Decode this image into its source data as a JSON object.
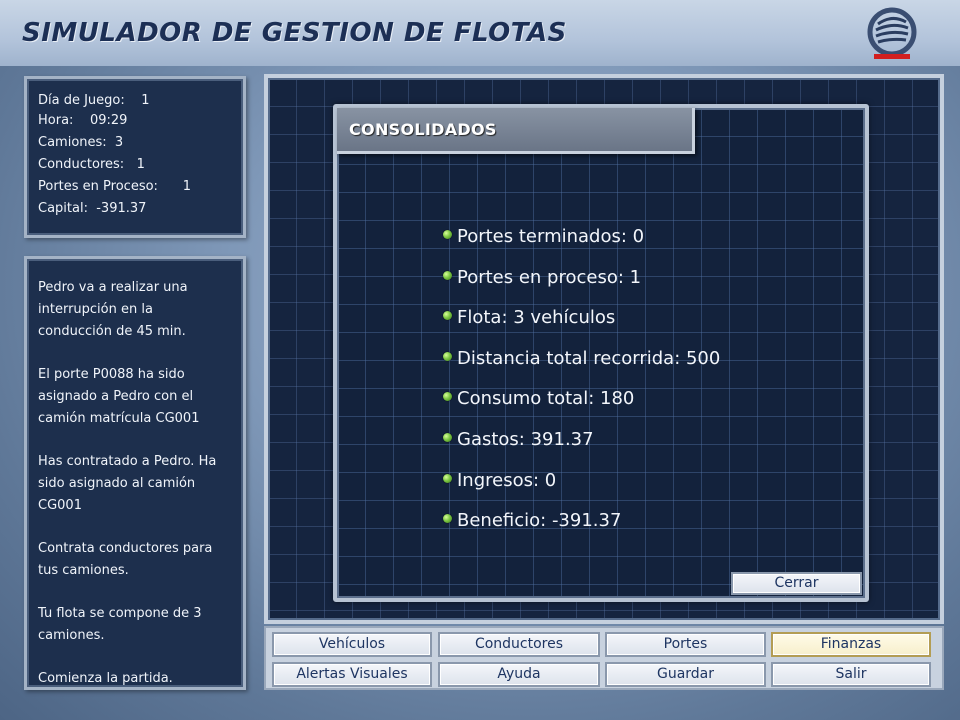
{
  "header": {
    "title": "SIMULADOR DE GESTION DE FLOTAS",
    "logo_icon": "company-logo-icon"
  },
  "stats": {
    "game_day": "Día de Juego:    1",
    "time": "Hora:    09:29",
    "trucks": "Camiones:  3",
    "drivers": "Conductores:   1",
    "jobs_in_progress": "Portes en Proceso:      1",
    "capital": "Capital:  -391.37"
  },
  "messages": [
    "Pedro va a realizar una\ninterrupción en la\nconducción de 45 min.",
    "El porte P0088 ha sido\nasignado a Pedro con el\ncamión matrícula CG001",
    "Has contratado a Pedro. Ha\nsido asignado al camión\nCG001",
    "Contrata conductores para\ntus camiones.",
    "Tu flota se compone de 3\ncamiones.",
    "Comienza la partida."
  ],
  "dialog": {
    "title": "CONSOLIDADOS",
    "items": [
      "Portes terminados: 0",
      "Portes en proceso: 1",
      "Flota: 3 vehículos",
      "Distancia total recorrida: 500",
      "Consumo total: 180",
      "Gastos: 391.37",
      "Ingresos: 0",
      "Beneficio: -391.37"
    ],
    "close_label": "Cerrar"
  },
  "nav": {
    "row1": [
      "Vehículos",
      "Conductores",
      "Portes",
      "Finanzas"
    ],
    "row2": [
      "Alertas Visuales",
      "Ayuda",
      "Guardar",
      "Salir"
    ],
    "active": "Finanzas"
  },
  "colors": {
    "panel_bg": "#1d2f4d",
    "title": "#1c2f55",
    "button_text": "#1e3562",
    "bullet": "#7cc742",
    "active_button": "#f7efcc"
  }
}
